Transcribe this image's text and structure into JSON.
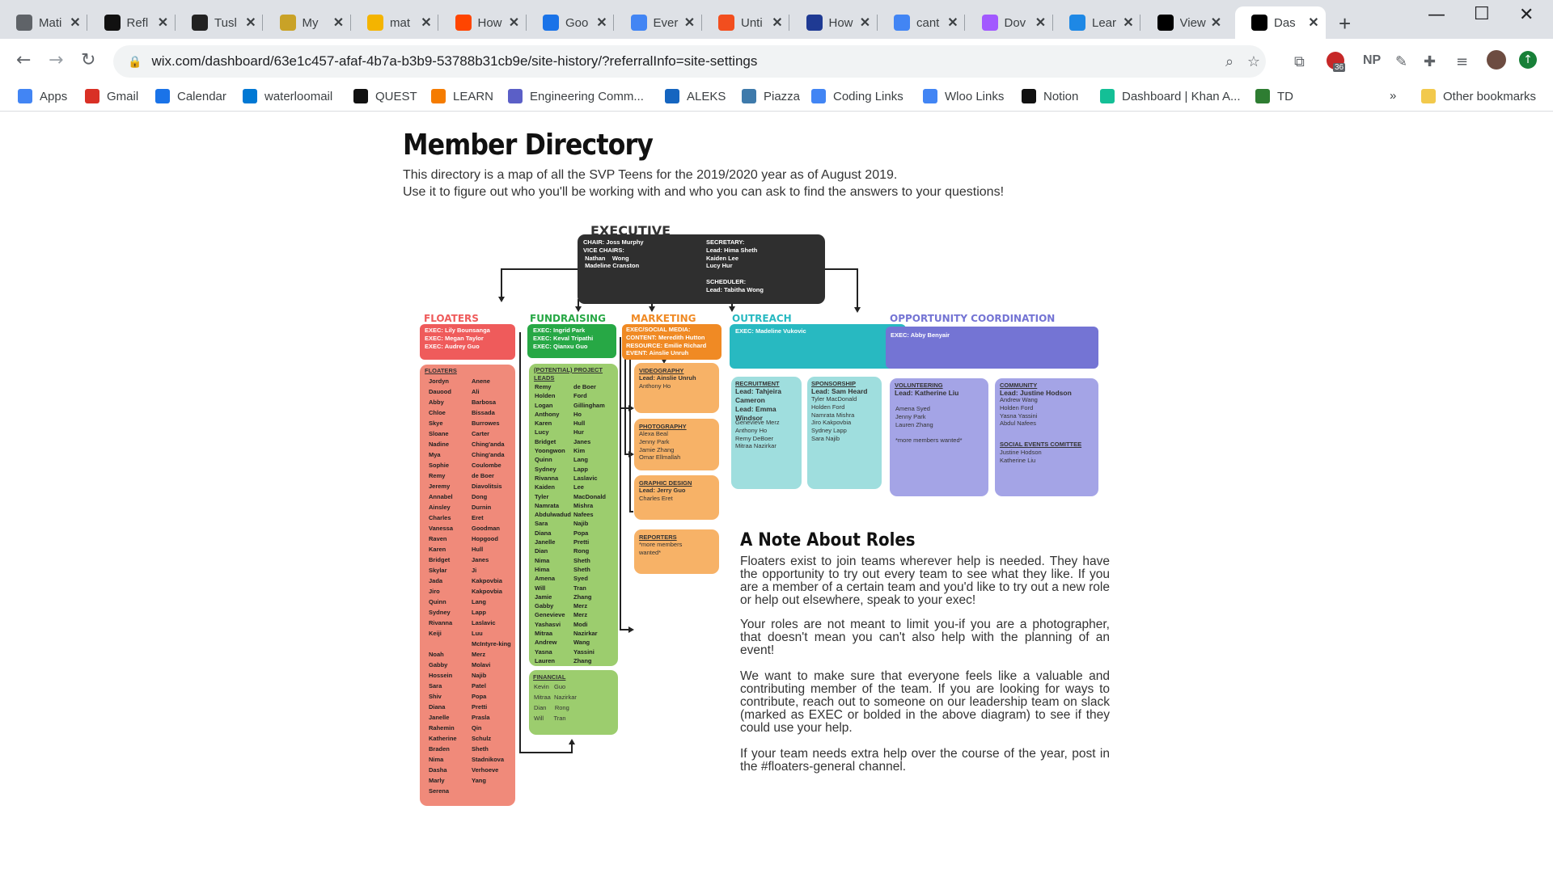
{
  "browser": {
    "tabs": [
      {
        "label": "Mati",
        "icon": "globe-icon",
        "color": "#5f6368"
      },
      {
        "label": "Refl",
        "icon": "medium-icon",
        "color": "#111111"
      },
      {
        "label": "Tusl",
        "icon": "tg-icon",
        "color": "#222222"
      },
      {
        "label": "My",
        "icon": "ninja-icon",
        "color": "#c9a227"
      },
      {
        "label": "mat",
        "icon": "yellow-face-icon",
        "color": "#f4b400"
      },
      {
        "label": "How",
        "icon": "reddit-icon",
        "color": "#ff4500"
      },
      {
        "label": "Goo",
        "icon": "calendar-icon",
        "color": "#1a73e8"
      },
      {
        "label": "Ever",
        "icon": "docs-icon",
        "color": "#4285f4"
      },
      {
        "label": "Unti",
        "icon": "figma-icon",
        "color": "#f24e1e"
      },
      {
        "label": "How",
        "icon": "quora-icon",
        "color": "#1f3a93"
      },
      {
        "label": "cant",
        "icon": "google-icon",
        "color": "#4285f4"
      },
      {
        "label": "Dov",
        "icon": "figma-icon",
        "color": "#a259ff"
      },
      {
        "label": "Lear",
        "icon": "learn-icon",
        "color": "#1e88e5"
      },
      {
        "label": "View",
        "icon": "wix-icon",
        "color": "#000000"
      },
      {
        "label": "Das",
        "icon": "wix-icon",
        "color": "#000000"
      }
    ],
    "url": "wix.com/dashboard/63e1c457-afaf-4b7a-b3b9-53788b31cb9e/site-history/?referralInfo=site-settings",
    "extension_badge": "36",
    "extension_np": "NP",
    "bookmarks": [
      {
        "label": "Apps",
        "icon": "apps-grid-icon",
        "color": "#4285f4"
      },
      {
        "label": "Gmail",
        "icon": "gmail-icon",
        "color": "#d93025"
      },
      {
        "label": "Calendar",
        "icon": "calendar-icon",
        "color": "#1a73e8"
      },
      {
        "label": "waterloomail",
        "icon": "outlook-icon",
        "color": "#0078d4"
      },
      {
        "label": "QUEST",
        "icon": "quest-w-icon",
        "color": "#111111"
      },
      {
        "label": "LEARN",
        "icon": "learn-icon",
        "color": "#f57c00"
      },
      {
        "label": "Engineering Comm...",
        "icon": "teams-icon",
        "color": "#5b5fc7"
      },
      {
        "label": "ALEKS",
        "icon": "aleks-icon",
        "color": "#1565c0"
      },
      {
        "label": "Piazza",
        "icon": "piazza-icon",
        "color": "#3e7aab"
      },
      {
        "label": "Coding Links",
        "icon": "docs-icon",
        "color": "#4285f4"
      },
      {
        "label": "Wloo Links",
        "icon": "docs-icon",
        "color": "#4285f4"
      },
      {
        "label": "Notion",
        "icon": "notion-icon",
        "color": "#111111"
      },
      {
        "label": "Dashboard | Khan A...",
        "icon": "khan-icon",
        "color": "#14bf96"
      },
      {
        "label": "TD",
        "icon": "td-icon",
        "color": "#2e7d32"
      }
    ],
    "bookmarks_more": "»",
    "other_bookmarks": "Other bookmarks"
  },
  "page": {
    "title": "Member Directory",
    "subtitle_1": "This directory is a map of all the SVP Teens for the 2019/2020 year as of August 2019.",
    "subtitle_2": "Use it to figure out who you'll be working with and who you can ask to find the answers to your questions!"
  },
  "diagram": {
    "executive": {
      "title": "EXECUTIVE",
      "left": "CHAIR: Joss Murphy\nVICE CHAIRS:\n Nathan    Wong\n Madeline Cranston",
      "right": "SECRETARY:\nLead: Hima Sheth\nKaiden Lee\nLucy Hur\n\nSCHEDULER:\nLead: Tabitha Wong"
    },
    "floaters": {
      "title": "FLOATERS",
      "execs": "EXEC: Lily Bounsanga\nEXEC: Megan Taylor\nEXEC: Audrey Guo",
      "list_title": "FLOATERS",
      "first": [
        "Jordyn",
        "Dauood",
        "Abby",
        "Chloe",
        "Skye",
        "Sloane",
        "Nadine",
        "Mya",
        "Sophie",
        "Remy",
        "Jeremy",
        "Annabel",
        "Ainsley",
        "Charles",
        "Vanessa",
        "Raven",
        "Karen",
        "Bridget",
        "Skylar",
        "Jada",
        "Jiro",
        "Quinn",
        "Sydney",
        "Rivanna",
        "Keiji",
        "",
        "Noah",
        "Gabby",
        "Hossein",
        "Sara",
        "Shiv",
        "Diana",
        "Janelle",
        "Rahemin",
        "Katherine",
        "Braden",
        "Nima",
        "Dasha",
        "Marly",
        "Serena"
      ],
      "last": [
        "Anene",
        "Ali",
        "Barbosa",
        "Bissada",
        "Burrowes",
        "Carter",
        "Ching'anda",
        "Ching'anda",
        "Coulombe",
        "de Boer",
        "Diavolitsis",
        "Dong",
        "Durnin",
        "Eret",
        "Goodman",
        "Hopgood",
        "Hull",
        "Janes",
        "Ji",
        "Kakpovbia",
        "Kakpovbia",
        "Lang",
        "Lapp",
        "Laslavic",
        "Luu",
        "McIntyre-king",
        "Merz",
        "Molavi",
        "Najib",
        "Patel",
        "Popa",
        "Pretti",
        "Prasla",
        "Qin",
        "Schulz",
        "Sheth",
        "Stadnikova",
        "Verhoeve",
        "Yang",
        ""
      ]
    },
    "fundraising": {
      "title": "FUNDRAISING",
      "execs": "EXEC: Ingrid Park\nEXEC: Keval Tripathi\nEXEC: Qianxu Guo",
      "list_title": "(POTENTIAL) PROJECT LEADS",
      "first": [
        "Remy",
        "Holden",
        "Logan",
        "Anthony",
        "Karen",
        "Lucy",
        "Bridget",
        "Yoongwon",
        "Quinn",
        "Sydney",
        "Rivanna",
        "Kaiden",
        "Tyler",
        "Namrata",
        "Abdulwadud",
        "Sara",
        "Diana",
        "Janelle",
        "Dian",
        "Nima",
        "Hima",
        "Amena",
        "Will",
        "Jamie",
        "Gabby",
        "Genevieve",
        "Yashasvi",
        "Mitraa",
        "Andrew",
        "Yasna",
        "Lauren"
      ],
      "last": [
        "de Boer",
        "Ford",
        "Gillingham",
        "Ho",
        "Hull",
        "Hur",
        "Janes",
        "Kim",
        "Lang",
        "Lapp",
        "Laslavic",
        "Lee",
        "MacDonald",
        "Mishra",
        "Nafees",
        "Najib",
        "Popa",
        "Pretti",
        "Rong",
        "Sheth",
        "Sheth",
        "Syed",
        "Tran",
        "Zhang",
        "Merz",
        "Merz",
        "Modi",
        "Nazirkar",
        "Wang",
        "Yassini",
        "Zhang"
      ],
      "financial_title": "FINANCIAL",
      "financial": "Kevin   Guo\nMitraa  Nazirkar\nDian     Rong\nWill      Tran"
    },
    "marketing": {
      "title": "MARKETING",
      "execs": "EXEC/SOCIAL MEDIA:\nCONTENT: Meredith Hutton\nRESOURCE: Emilie Richard\nEVENT: Ainslie Unruh",
      "sub": [
        {
          "title": "VIDEOGRAPHY",
          "body": "Lead: Ainslie Unruh",
          "extra": "Anthony Ho"
        },
        {
          "title": "PHOTOGRAPHY",
          "body": "",
          "extra": "Alexa Beal\nJenny Park\nJamie Zhang\nOmar Ellmallah"
        },
        {
          "title": "GRAPHIC DESIGN",
          "body": "Lead: Jerry Guo",
          "extra": "Charles Eret"
        },
        {
          "title": "REPORTERS",
          "body": "",
          "extra": "*more members\nwanted*"
        }
      ]
    },
    "outreach": {
      "title": "OUTREACH",
      "execs": "EXEC: Madeline Vukovic",
      "recruitment_title": "RECRUITMENT",
      "recruitment_leads": "Lead: Tahjeira\nCameron\nLead: Emma\nWindsor",
      "recruitment_members": "Genevieve Merz\nAnthony Ho\nRemy DeBoer\nMitraa Nazirkar",
      "sponsorship_title": "SPONSORSHIP",
      "sponsorship_lead": "Lead: Sam Heard",
      "sponsorship_members": "Tyler MacDonald\nHolden Ford\nNamrata Mishra\nJiro Kakpovbia\nSydney Lapp\nSara Najib"
    },
    "opportunity": {
      "title": "OPPORTUNITY COORDINATION",
      "execs": "EXEC: Abby Benyair",
      "volunteering_title": "VOLUNTEERING",
      "volunteering_lead": "Lead: Katherine Liu",
      "volunteering_members": "Amena Syed\nJenny Park\nLauren Zhang\n\n*more members wanted*",
      "community_title": "COMMUNITY",
      "community_lead": "Lead: Justine Hodson",
      "community_members": "Andrew Wang\nHolden Ford\nYasna Yassini\nAbdul Nafees",
      "social_title": "SOCIAL EVENTS COMITTEE",
      "social_members": "Justine Hodson\nKatherine Liu"
    }
  },
  "note": {
    "title": "A Note About Roles",
    "p1": "Floaters exist to join teams wherever help is needed. They have the opportunity to try out every team to see what they like. If you are a member of a certain team and you'd like to try out a new role or help out elsewhere, speak to your exec!",
    "p2": "Your roles are not meant to limit you-if you are a photographer, that doesn't mean you can't also help with the planning of an event!",
    "p3": "We want to make sure that everyone feels like a valuable and contributing member of the team. If you are looking for ways to contribute, reach out to someone on our leadership team on slack (marked as EXEC or bolded in the above diagram) to see if they could use your help.",
    "p4": "If your team needs extra help over the course of the year, post in the #floaters-general channel."
  },
  "colors": {
    "floaters": "#f08a7a",
    "floaters_header": "#ef5b5b",
    "fundraising": "#9ccd6e",
    "fundraising_header": "#27a845",
    "marketing": "#f7b267",
    "marketing_header": "#f08a24",
    "outreach": "#9fdede",
    "outreach_header": "#28b9c1",
    "opportunity": "#a4a4e6",
    "opportunity_header": "#7474d4",
    "executive": "#2f2f2f"
  }
}
